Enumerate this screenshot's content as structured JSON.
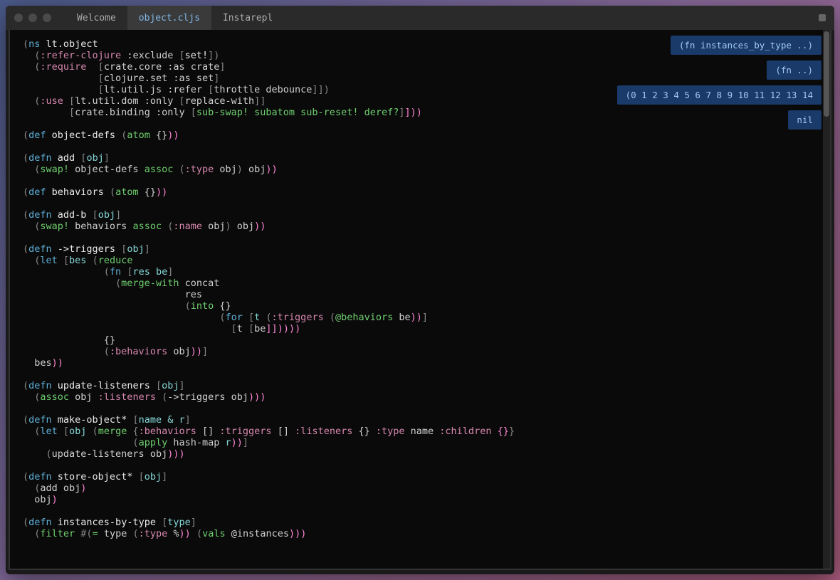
{
  "tabs": {
    "welcome": "Welcome",
    "object": "object.cljs",
    "instarepl": "Instarepl"
  },
  "hints": {
    "h1": "(fn instances_by_type ..)",
    "h2": "(fn  ..)",
    "h3": "(0 1 2 3 4 5 6 7 8 9 10 11 12 13 14",
    "h4": "nil"
  },
  "code": {
    "l01a": "(",
    "l01b": "ns",
    "l01c": " lt.object",
    "l02a": "  (",
    "l02b": ":refer-clojure",
    "l02c": " :exclude ",
    "l02d": "[",
    "l02e": "set!",
    "l02f": "]",
    "l02g": ")",
    "l03a": "  (",
    "l03b": ":require",
    "l03c": "  [",
    "l03d": "crate.core",
    "l03e": " :as ",
    "l03f": "crate",
    "l03g": "]",
    "l04a": "             [",
    "l04b": "clojure.set",
    "l04c": " :as ",
    "l04d": "set",
    "l04e": "]",
    "l05a": "             [",
    "l05b": "lt.util.js",
    "l05c": " :refer ",
    "l05d": "[",
    "l05e": "throttle debounce",
    "l05f": "]",
    "l05g": "]",
    "l05h": ")",
    "l06a": "  (",
    "l06b": ":use",
    "l06c": " [",
    "l06d": "lt.util.dom",
    "l06e": " :only ",
    "l06f": "[",
    "l06g": "replace-with",
    "l06h": "]",
    "l06i": "]",
    "l07a": "        [",
    "l07b": "crate.binding",
    "l07c": " :only ",
    "l07d": "[",
    "l07e": "sub-swap! subatom sub-reset! deref?",
    "l07f": "]",
    "l07g": "]",
    "l07h": ")",
    "l07i": ")",
    "l09a": "(",
    "l09b": "def",
    "l09c": " object-defs ",
    "l09d": "(",
    "l09e": "atom",
    "l09f": " {}",
    "l09g": ")",
    "l09h": ")",
    "l11a": "(",
    "l11b": "defn",
    "l11c": " add ",
    "l11d": "[",
    "l11e": "obj",
    "l11f": "]",
    "l12a": "  (",
    "l12b": "swap!",
    "l12c": " object-defs ",
    "l12d": "assoc",
    "l12e": " (",
    "l12f": ":type",
    "l12g": " obj",
    "l12h": ")",
    "l12i": " obj",
    "l12j": ")",
    "l12k": ")",
    "l14a": "(",
    "l14b": "def",
    "l14c": " behaviors ",
    "l14d": "(",
    "l14e": "atom",
    "l14f": " {}",
    "l14g": ")",
    "l14h": ")",
    "l16a": "(",
    "l16b": "defn",
    "l16c": " add-b ",
    "l16d": "[",
    "l16e": "obj",
    "l16f": "]",
    "l17a": "  (",
    "l17b": "swap!",
    "l17c": " behaviors ",
    "l17d": "assoc",
    "l17e": " (",
    "l17f": ":name",
    "l17g": " obj",
    "l17h": ")",
    "l17i": " obj",
    "l17j": ")",
    "l17k": ")",
    "l19a": "(",
    "l19b": "defn",
    "l19c": " ->triggers ",
    "l19d": "[",
    "l19e": "obj",
    "l19f": "]",
    "l20a": "  (",
    "l20b": "let",
    "l20c": " [",
    "l20d": "bes",
    "l20e": " (",
    "l20f": "reduce",
    "l21a": "              (",
    "l21b": "fn",
    "l21c": " [",
    "l21d": "res be",
    "l21e": "]",
    "l22a": "                (",
    "l22b": "merge-with",
    "l22c": " concat",
    "l23a": "                            res",
    "l24a": "                            (",
    "l24b": "into",
    "l24c": " {}",
    "l25a": "                                  (",
    "l25b": "for",
    "l25c": " [",
    "l25d": "t",
    "l25e": " (",
    "l25f": ":triggers",
    "l25g": " (",
    "l25h": "@behaviors",
    "l25i": " be",
    "l25j": ")",
    "l25k": ")",
    "l25l": "]",
    "l26a": "                                    [",
    "l26b": "t",
    "l26c": " [",
    "l26d": "be",
    "l26e": "]",
    "l26f": "]",
    "l26g": ")",
    "l26h": ")",
    "l26i": ")",
    "l26j": ")",
    "l27a": "              {}",
    "l28a": "              (",
    "l28b": ":behaviors",
    "l28c": " obj",
    "l28d": ")",
    "l28e": ")",
    "l28f": "]",
    "l29a": "  bes",
    "l29b": ")",
    "l29c": ")",
    "l31a": "(",
    "l31b": "defn",
    "l31c": " update-listeners ",
    "l31d": "[",
    "l31e": "obj",
    "l31f": "]",
    "l32a": "  (",
    "l32b": "assoc",
    "l32c": " obj ",
    "l32d": ":listeners",
    "l32e": " (",
    "l32f": "->triggers",
    "l32g": " obj",
    "l32h": ")",
    "l32i": ")",
    "l32j": ")",
    "l34a": "(",
    "l34b": "defn",
    "l34c": " make-object* ",
    "l34d": "[",
    "l34e": "name & r",
    "l34f": "]",
    "l35a": "  (",
    "l35b": "let",
    "l35c": " [",
    "l35d": "obj",
    "l35e": " (",
    "l35f": "merge",
    "l35g": " {",
    "l35h": ":behaviors",
    "l35i": " [] ",
    "l35j": ":triggers",
    "l35k": " [] ",
    "l35l": ":listeners",
    "l35m": " {} ",
    "l35n": ":type",
    "l35o": " name ",
    "l35p": ":children",
    "l35q": " {}",
    "l35r": "}",
    "l36a": "                   (",
    "l36b": "apply",
    "l36c": " hash-map ",
    "l36d": "r",
    "l36e": ")",
    "l36f": ")",
    "l36g": "]",
    "l37a": "    (",
    "l37b": "update-listeners",
    "l37c": " obj",
    "l37d": ")",
    "l37e": ")",
    "l37f": ")",
    "l39a": "(",
    "l39b": "defn",
    "l39c": " store-object* ",
    "l39d": "[",
    "l39e": "obj",
    "l39f": "]",
    "l40a": "  (",
    "l40b": "add",
    "l40c": " obj",
    "l40d": ")",
    "l41a": "  obj",
    "l41b": ")",
    "l43a": "(",
    "l43b": "defn",
    "l43c": " instances-by-type ",
    "l43d": "[",
    "l43e": "type",
    "l43f": "]",
    "l44a": "  (",
    "l44b": "filter",
    "l44c": " #(",
    "l44d": "=",
    "l44e": " type ",
    "l44f": "(",
    "l44g": ":type",
    "l44h": " %",
    "l44i": ")",
    "l44j": ")",
    "l44k": " (",
    "l44l": "vals",
    "l44m": " @instances",
    "l44n": ")",
    "l44o": ")",
    "l44p": ")"
  }
}
